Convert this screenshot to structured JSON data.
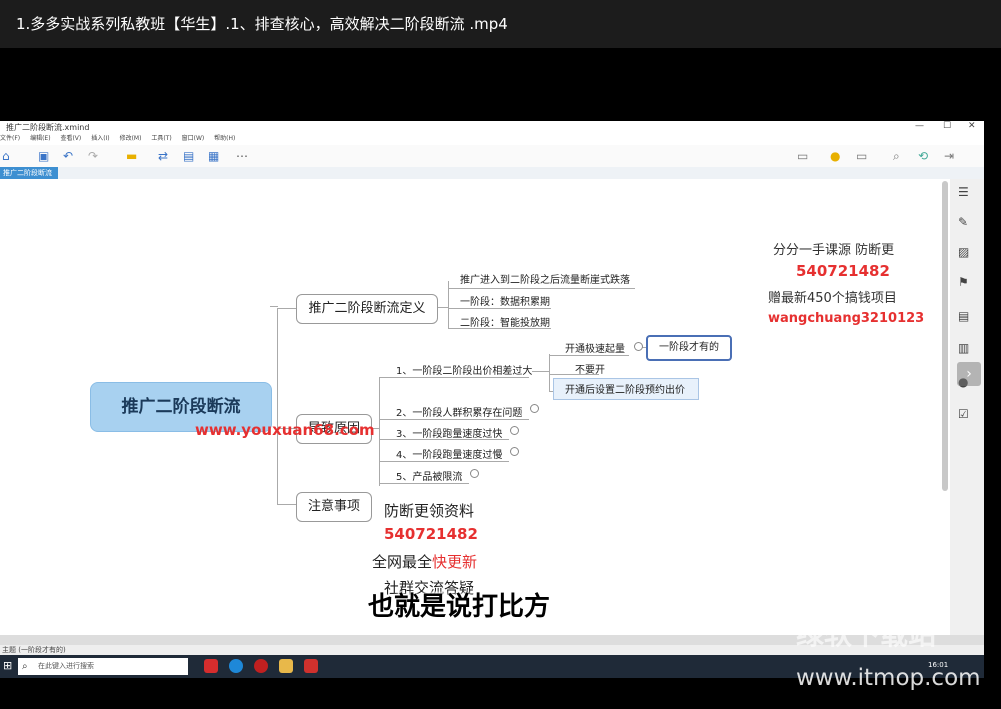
{
  "window": {
    "title": "1.多多实战系列私教班【华生】.1、排查核心，高效解决二阶段断流 .mp4"
  },
  "app": {
    "title": "推广二阶段断流.xmind",
    "menu": [
      "文件(F)",
      "编辑(E)",
      "查看(V)",
      "插入(I)",
      "修改(M)",
      "工具(T)",
      "窗口(W)",
      "帮助(H)"
    ],
    "tab": "推广二阶段断流"
  },
  "mindmap": {
    "root": "推广二阶段断流",
    "definition": {
      "label": "推广二阶段断流定义",
      "items": [
        "推广进入到二阶段之后流量断崖式跌落",
        "一阶段：数据积累期",
        "二阶段：智能投放期"
      ]
    },
    "causes": {
      "label": "导致原因",
      "items": [
        "1、一阶段二阶段出价相差过大",
        "2、一阶段人群积累存在问题",
        "3、一阶段跑量速度过快",
        "4、一阶段跑量速度过慢",
        "5、产品被限流"
      ],
      "subitems": [
        "开通极速起量",
        "不要开",
        "开通后设置二阶段预约出价"
      ],
      "highlight": "一阶段才有的"
    },
    "notes": {
      "label": "注意事项"
    }
  },
  "overlays": {
    "promo_right_1": "分分一手课源 防断更",
    "promo_right_2": "540721482",
    "promo_right_3": "赠最新450个搞钱项目",
    "promo_right_4": "wangchuang3210123",
    "site_watermark": "www.youxuan68.com",
    "promo_left_1": "防断更领资料",
    "promo_left_2": "540721482",
    "promo_left_3a": "全网最全",
    "promo_left_3b": "快更新",
    "promo_left_4": "社群交流答疑"
  },
  "subtitle": "也就是说打比方",
  "statusbar": {
    "text": "主题 (一阶段才有的)"
  },
  "taskbar": {
    "search_placeholder": "在此键入进行搜索",
    "time": "16:01"
  },
  "watermark": {
    "line1": "绿软下载站",
    "line2": "www.itmop.com"
  }
}
